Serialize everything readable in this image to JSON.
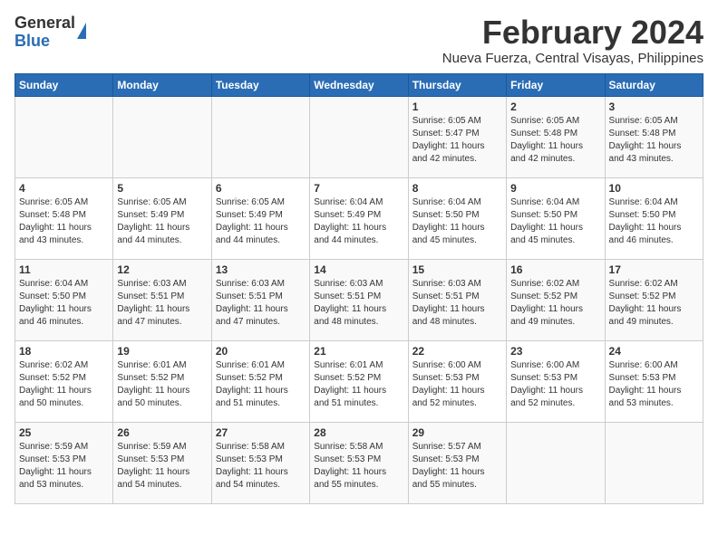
{
  "header": {
    "logo_general": "General",
    "logo_blue": "Blue",
    "month_title": "February 2024",
    "location": "Nueva Fuerza, Central Visayas, Philippines"
  },
  "days_of_week": [
    "Sunday",
    "Monday",
    "Tuesday",
    "Wednesday",
    "Thursday",
    "Friday",
    "Saturday"
  ],
  "weeks": [
    [
      {
        "day": "",
        "info": ""
      },
      {
        "day": "",
        "info": ""
      },
      {
        "day": "",
        "info": ""
      },
      {
        "day": "",
        "info": ""
      },
      {
        "day": "1",
        "info": "Sunrise: 6:05 AM\nSunset: 5:47 PM\nDaylight: 11 hours\nand 42 minutes."
      },
      {
        "day": "2",
        "info": "Sunrise: 6:05 AM\nSunset: 5:48 PM\nDaylight: 11 hours\nand 42 minutes."
      },
      {
        "day": "3",
        "info": "Sunrise: 6:05 AM\nSunset: 5:48 PM\nDaylight: 11 hours\nand 43 minutes."
      }
    ],
    [
      {
        "day": "4",
        "info": "Sunrise: 6:05 AM\nSunset: 5:48 PM\nDaylight: 11 hours\nand 43 minutes."
      },
      {
        "day": "5",
        "info": "Sunrise: 6:05 AM\nSunset: 5:49 PM\nDaylight: 11 hours\nand 44 minutes."
      },
      {
        "day": "6",
        "info": "Sunrise: 6:05 AM\nSunset: 5:49 PM\nDaylight: 11 hours\nand 44 minutes."
      },
      {
        "day": "7",
        "info": "Sunrise: 6:04 AM\nSunset: 5:49 PM\nDaylight: 11 hours\nand 44 minutes."
      },
      {
        "day": "8",
        "info": "Sunrise: 6:04 AM\nSunset: 5:50 PM\nDaylight: 11 hours\nand 45 minutes."
      },
      {
        "day": "9",
        "info": "Sunrise: 6:04 AM\nSunset: 5:50 PM\nDaylight: 11 hours\nand 45 minutes."
      },
      {
        "day": "10",
        "info": "Sunrise: 6:04 AM\nSunset: 5:50 PM\nDaylight: 11 hours\nand 46 minutes."
      }
    ],
    [
      {
        "day": "11",
        "info": "Sunrise: 6:04 AM\nSunset: 5:50 PM\nDaylight: 11 hours\nand 46 minutes."
      },
      {
        "day": "12",
        "info": "Sunrise: 6:03 AM\nSunset: 5:51 PM\nDaylight: 11 hours\nand 47 minutes."
      },
      {
        "day": "13",
        "info": "Sunrise: 6:03 AM\nSunset: 5:51 PM\nDaylight: 11 hours\nand 47 minutes."
      },
      {
        "day": "14",
        "info": "Sunrise: 6:03 AM\nSunset: 5:51 PM\nDaylight: 11 hours\nand 48 minutes."
      },
      {
        "day": "15",
        "info": "Sunrise: 6:03 AM\nSunset: 5:51 PM\nDaylight: 11 hours\nand 48 minutes."
      },
      {
        "day": "16",
        "info": "Sunrise: 6:02 AM\nSunset: 5:52 PM\nDaylight: 11 hours\nand 49 minutes."
      },
      {
        "day": "17",
        "info": "Sunrise: 6:02 AM\nSunset: 5:52 PM\nDaylight: 11 hours\nand 49 minutes."
      }
    ],
    [
      {
        "day": "18",
        "info": "Sunrise: 6:02 AM\nSunset: 5:52 PM\nDaylight: 11 hours\nand 50 minutes."
      },
      {
        "day": "19",
        "info": "Sunrise: 6:01 AM\nSunset: 5:52 PM\nDaylight: 11 hours\nand 50 minutes."
      },
      {
        "day": "20",
        "info": "Sunrise: 6:01 AM\nSunset: 5:52 PM\nDaylight: 11 hours\nand 51 minutes."
      },
      {
        "day": "21",
        "info": "Sunrise: 6:01 AM\nSunset: 5:52 PM\nDaylight: 11 hours\nand 51 minutes."
      },
      {
        "day": "22",
        "info": "Sunrise: 6:00 AM\nSunset: 5:53 PM\nDaylight: 11 hours\nand 52 minutes."
      },
      {
        "day": "23",
        "info": "Sunrise: 6:00 AM\nSunset: 5:53 PM\nDaylight: 11 hours\nand 52 minutes."
      },
      {
        "day": "24",
        "info": "Sunrise: 6:00 AM\nSunset: 5:53 PM\nDaylight: 11 hours\nand 53 minutes."
      }
    ],
    [
      {
        "day": "25",
        "info": "Sunrise: 5:59 AM\nSunset: 5:53 PM\nDaylight: 11 hours\nand 53 minutes."
      },
      {
        "day": "26",
        "info": "Sunrise: 5:59 AM\nSunset: 5:53 PM\nDaylight: 11 hours\nand 54 minutes."
      },
      {
        "day": "27",
        "info": "Sunrise: 5:58 AM\nSunset: 5:53 PM\nDaylight: 11 hours\nand 54 minutes."
      },
      {
        "day": "28",
        "info": "Sunrise: 5:58 AM\nSunset: 5:53 PM\nDaylight: 11 hours\nand 55 minutes."
      },
      {
        "day": "29",
        "info": "Sunrise: 5:57 AM\nSunset: 5:53 PM\nDaylight: 11 hours\nand 55 minutes."
      },
      {
        "day": "",
        "info": ""
      },
      {
        "day": "",
        "info": ""
      }
    ]
  ]
}
